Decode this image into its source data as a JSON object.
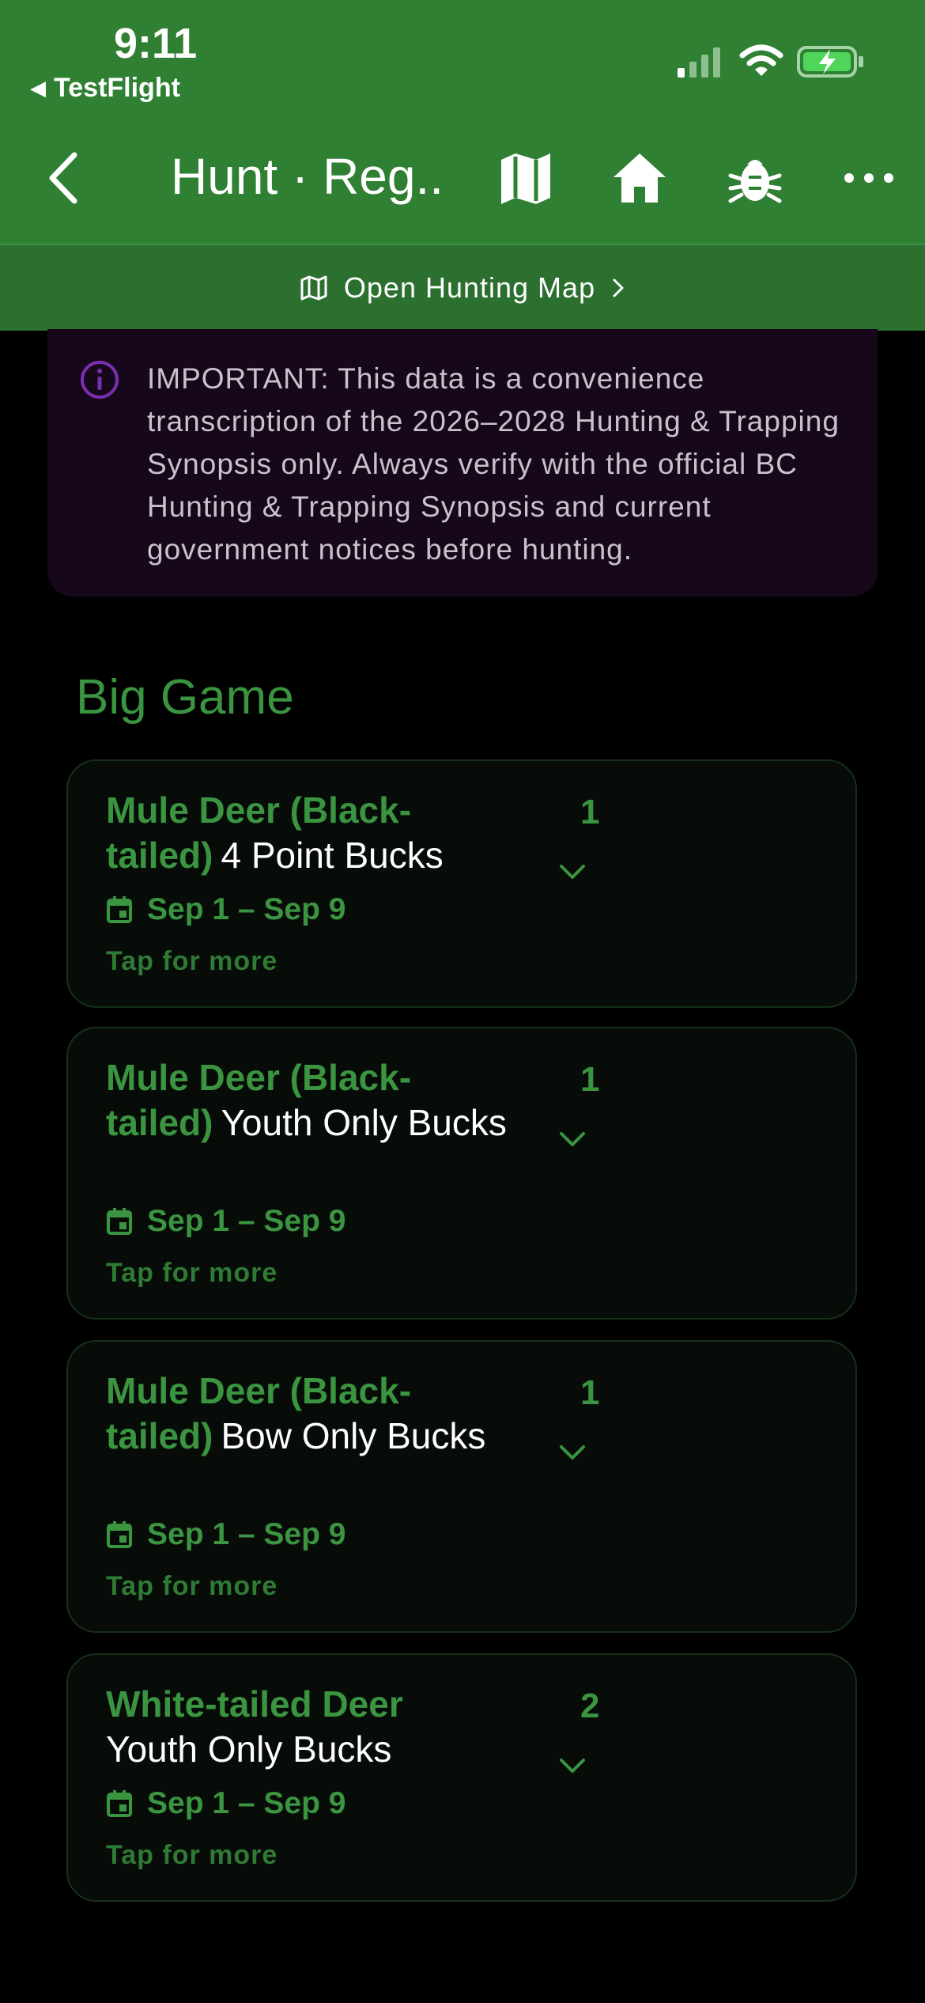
{
  "status": {
    "time": "9:11",
    "back_app": "TestFlight"
  },
  "nav": {
    "title": "Hunt · Reg...",
    "icons": [
      "back-chevron-icon",
      "map-icon",
      "home-icon",
      "bug-icon",
      "more-icon"
    ]
  },
  "map_bar": {
    "label": "Open Hunting Map",
    "icon": "map-outline-icon"
  },
  "notice": {
    "text": "IMPORTANT: This data is a convenience transcription of the 2026–2028 Hunting & Trapping Synopsis only. Always verify with the official BC Hunting & Trapping Synopsis and current government notices before hunting."
  },
  "section": {
    "title": "Big Game"
  },
  "cards": [
    {
      "species": "Mule Deer (Black-tailed)",
      "detail": "4 Point Bucks",
      "date": "Sep 1 – Sep 9",
      "more": "Tap for more",
      "count": "1"
    },
    {
      "species": "Mule Deer (Black-tailed)",
      "detail": "Youth Only Bucks",
      "date": "Sep 1 – Sep 9",
      "more": "Tap for more",
      "count": "1"
    },
    {
      "species": "Mule Deer (Black-tailed)",
      "detail": "Bow Only Bucks",
      "date": "Sep 1 – Sep 9",
      "more": "Tap for more",
      "count": "1"
    },
    {
      "species": "White-tailed Deer",
      "detail": "Youth Only Bucks",
      "date": "Sep 1 – Sep 9",
      "more": "Tap for more",
      "count": "2"
    }
  ],
  "colors": {
    "header_green": "#2f8033",
    "accent_green": "#3a9440",
    "notice_bg": "#16081a",
    "notice_icon": "#7a2fb0"
  }
}
